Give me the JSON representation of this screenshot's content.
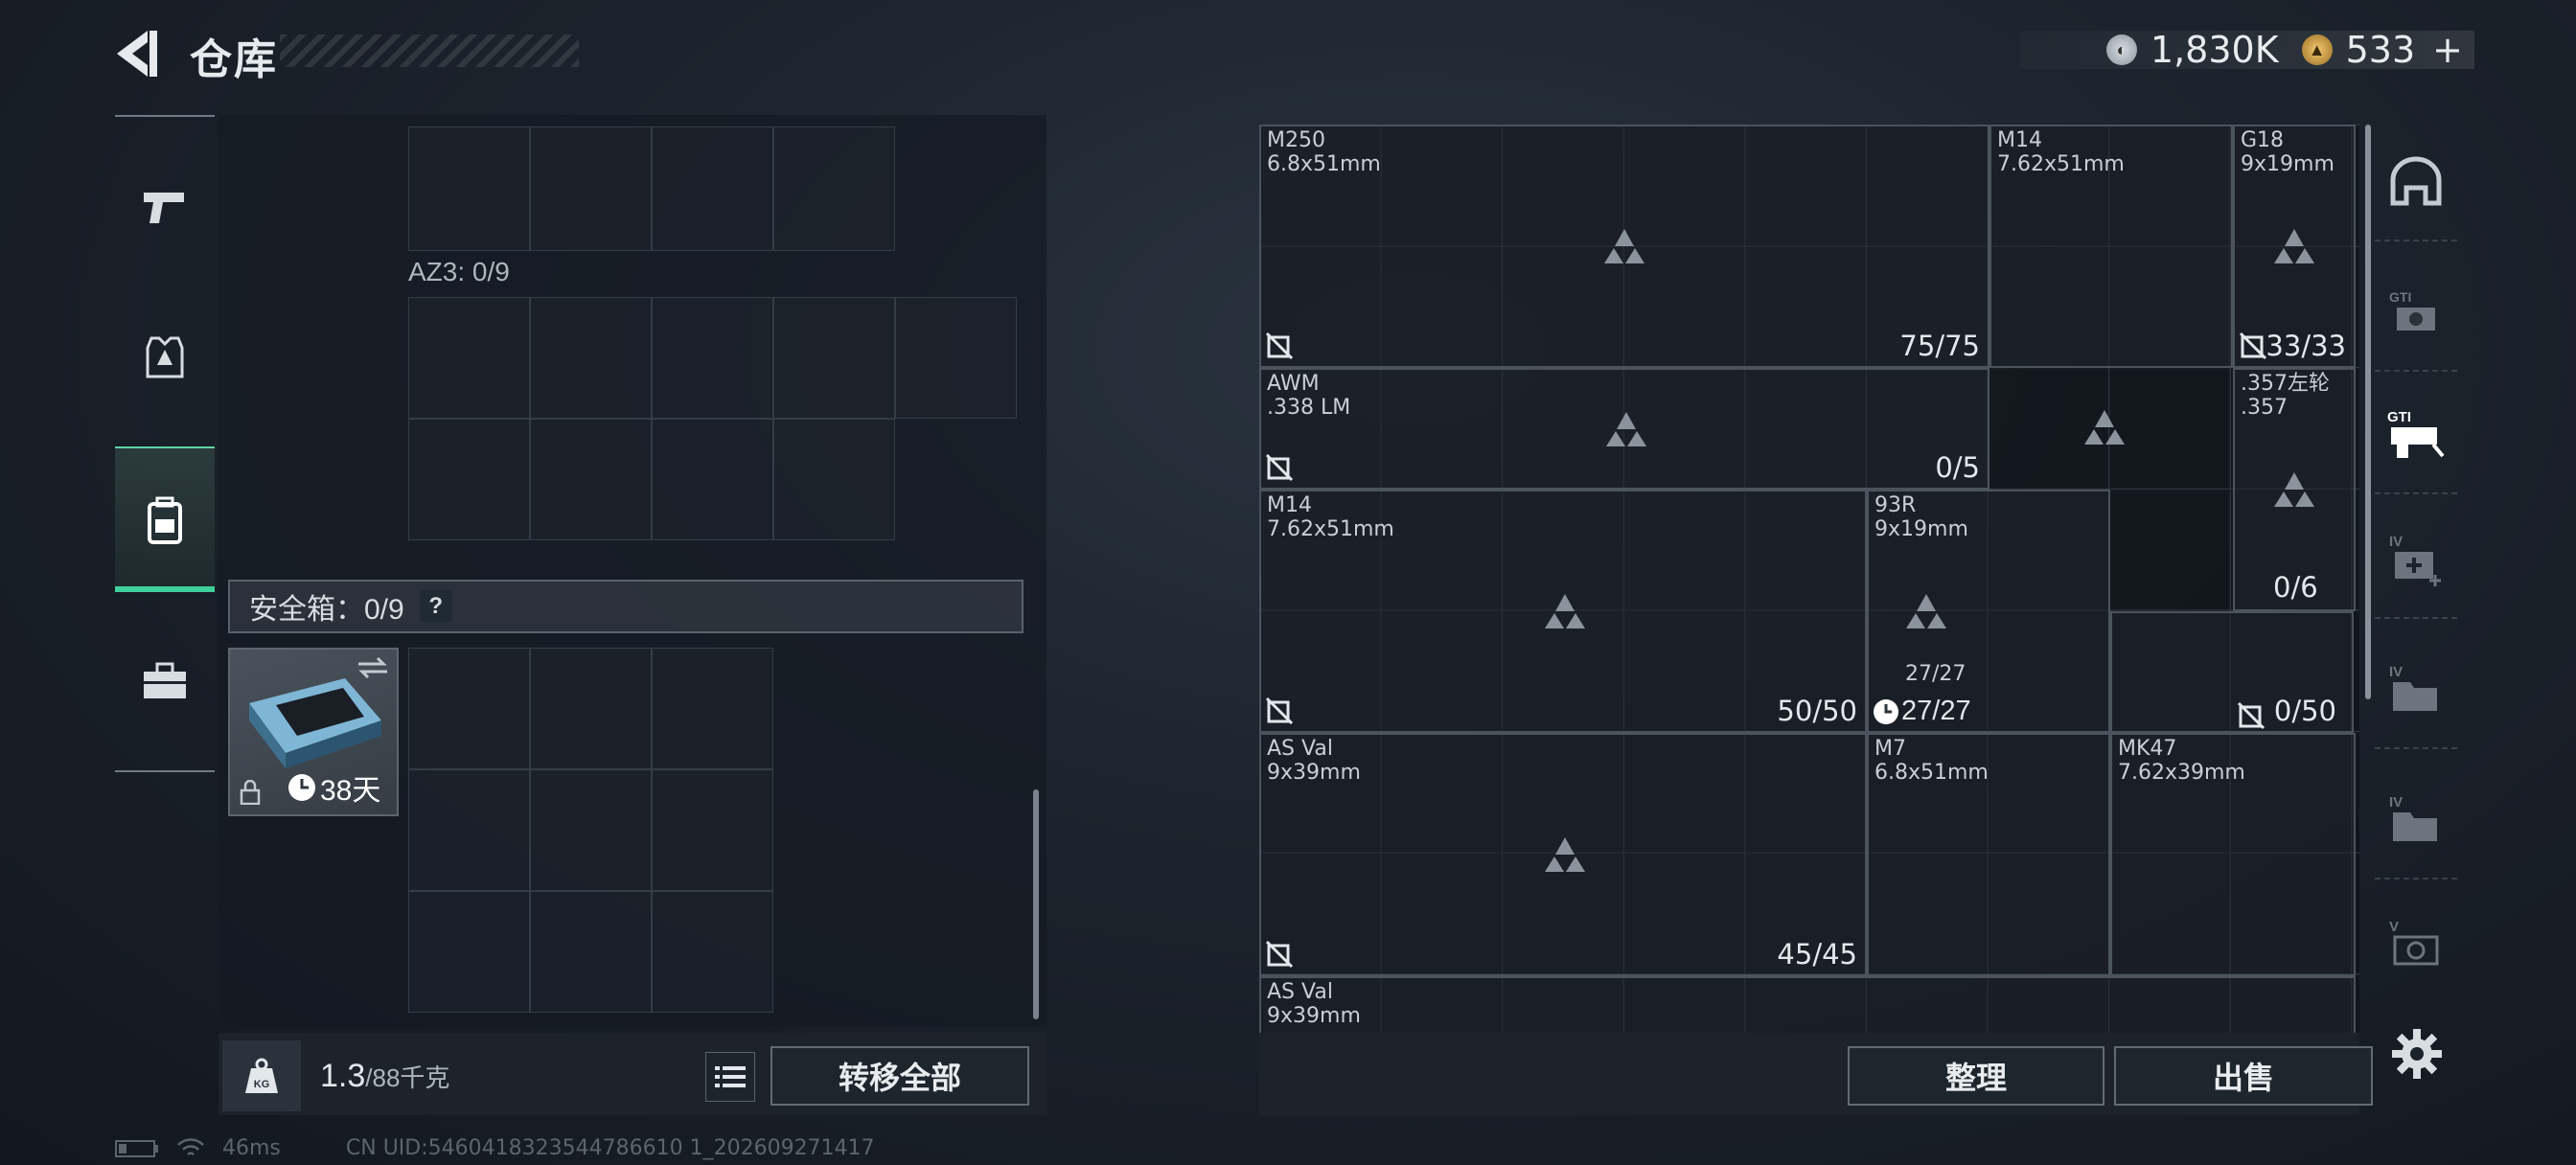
{
  "header": {
    "title": "仓库",
    "currency": [
      {
        "icon": "silver-coin-icon",
        "value": "1,830K"
      },
      {
        "icon": "gold-coin-icon",
        "value": "533"
      }
    ],
    "add_symbol": "+"
  },
  "left_tabs": [
    {
      "name": "weapons",
      "icon": "pistol-icon"
    },
    {
      "name": "armor",
      "icon": "vest-icon"
    },
    {
      "name": "backpack",
      "icon": "backpack-icon",
      "active": true
    },
    {
      "name": "toolbox",
      "icon": "toolbox-icon"
    }
  ],
  "storage": {
    "az3_label": "AZ3: 0/9",
    "safe_label": "安全箱：0/9",
    "safe_help": "?",
    "safe_item_timer": "38天",
    "weight_value": "1.3",
    "weight_unit": "/88千克",
    "transfer_all": "转移全部"
  },
  "inventory_items": [
    {
      "name": "M250",
      "caliber": "6.8x51mm",
      "count": "75/75"
    },
    {
      "name": "M14",
      "caliber": "7.62x51mm",
      "count": ""
    },
    {
      "name": "G18",
      "caliber": "9x19mm",
      "count": "33/33"
    },
    {
      "name": "AWM",
      "caliber": ".338 LM",
      "count": "0/5"
    },
    {
      "name": ".357左轮",
      "caliber": ".357",
      "count": ""
    },
    {
      "name": "M14",
      "caliber": "7.62x51mm",
      "count": "50/50"
    },
    {
      "name": "93R",
      "caliber": "9x19mm",
      "count": "27/27",
      "extra": "27/27"
    },
    {
      "name": "",
      "caliber": "",
      "count": "0/50"
    },
    {
      "name": "",
      "caliber": "",
      "count": "0/6"
    },
    {
      "name": "AS Val",
      "caliber": "9x39mm",
      "count": "45/45"
    },
    {
      "name": "M7",
      "caliber": "6.8x51mm",
      "count": ""
    },
    {
      "name": "MK47",
      "caliber": "7.62x39mm",
      "count": ""
    },
    {
      "name": "AS Val",
      "caliber": "9x39mm",
      "count": ""
    }
  ],
  "actions": {
    "organize": "整理",
    "sell": "出售"
  },
  "right_sidebar": [
    {
      "icon": "helmet-icon"
    },
    {
      "icon": "gti-camera-icon",
      "label": "GTI"
    },
    {
      "icon": "gti-gun-icon",
      "label": "GTI"
    },
    {
      "icon": "iv-medkit-icon",
      "label": "IV"
    },
    {
      "icon": "iv-folder-icon",
      "label": "IV"
    },
    {
      "icon": "iv-folder-icon",
      "label": "IV"
    },
    {
      "icon": "v-camera-icon",
      "label": "V"
    }
  ],
  "status": {
    "ping": "46ms",
    "uid": "CN UID:5460418323544786610 1_202609271417"
  }
}
